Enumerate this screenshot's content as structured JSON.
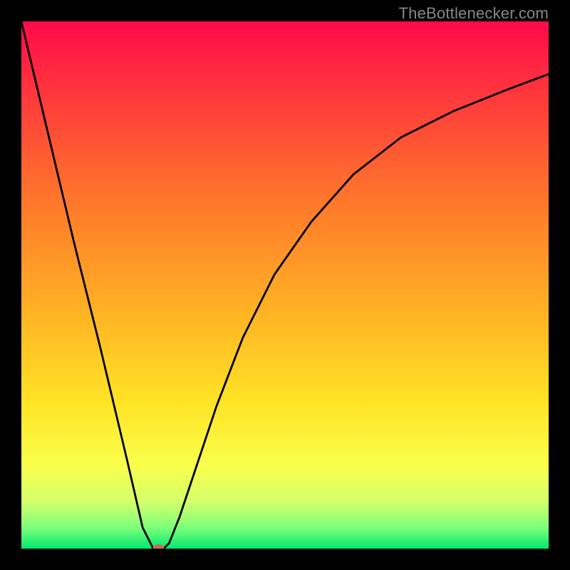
{
  "watermark": "TheBottlenecker.com",
  "chart_data": {
    "type": "line",
    "title": "",
    "xlabel": "",
    "ylabel": "",
    "xlim": [
      0,
      100
    ],
    "ylim": [
      0,
      100
    ],
    "background": {
      "type": "vertical-gradient",
      "stops": [
        {
          "offset": 0.0,
          "color": "#ff0a4a"
        },
        {
          "offset": 0.15,
          "color": "#ff3b3b"
        },
        {
          "offset": 0.35,
          "color": "#ff7a2a"
        },
        {
          "offset": 0.55,
          "color": "#ffb224"
        },
        {
          "offset": 0.72,
          "color": "#ffe325"
        },
        {
          "offset": 0.84,
          "color": "#faff4a"
        },
        {
          "offset": 0.91,
          "color": "#d4ff6a"
        },
        {
          "offset": 0.96,
          "color": "#7fff7a"
        },
        {
          "offset": 1.0,
          "color": "#00e870"
        }
      ]
    },
    "series": [
      {
        "name": "bottleneck-curve",
        "stroke": "#000000",
        "stroke_width": 2.8,
        "x": [
          0,
          5,
          10,
          15,
          20,
          23,
          25,
          26,
          27,
          28,
          30,
          33,
          37,
          42,
          48,
          55,
          63,
          72,
          82,
          92,
          100
        ],
        "y": [
          100,
          79,
          58,
          38,
          17,
          4,
          0,
          0,
          0,
          1,
          6,
          15,
          27,
          40,
          52,
          62,
          71,
          78,
          83,
          87,
          90
        ]
      }
    ],
    "marker": {
      "name": "current-point",
      "x": 26,
      "y": 0,
      "rx": 8,
      "ry": 6,
      "fill": "#c96a55"
    }
  }
}
